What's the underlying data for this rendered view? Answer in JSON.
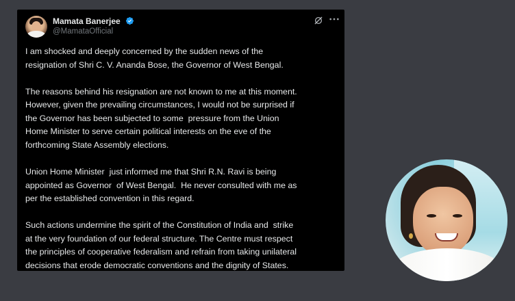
{
  "tweet": {
    "author_name": "Mamata Banerjee",
    "author_handle": "@MamataOfficial",
    "verified_color": "#1d9bf0",
    "paragraphs": [
      "I am shocked and deeply concerned by the sudden news of the\nresignation of Shri C. V. Ananda Bose, the Governor of West Bengal.",
      "The reasons behind his resignation are not known to me at this moment.\nHowever, given the prevailing circumstances, I would not be surprised if\nthe Governor has been subjected to some  pressure from the Union\nHome Minister to serve certain political interests on the eve of the\nforthcoming State Assembly elections.",
      "Union Home Minister  just informed me that Shri R.N. Ravi is being\nappointed as Governor  of West Bengal.  He never consulted with me as\nper the established convention in this regard.",
      "Such actions undermine the spirit of the Constitution of India and  strike\nat the very foundation of our federal structure. The Centre must respect\nthe principles of cooperative federalism and refrain from taking unilateral\ndecisions that erode democratic conventions and the dignity of States."
    ],
    "icons": {
      "grok": "grok-icon",
      "more": "more-options-icon"
    }
  }
}
